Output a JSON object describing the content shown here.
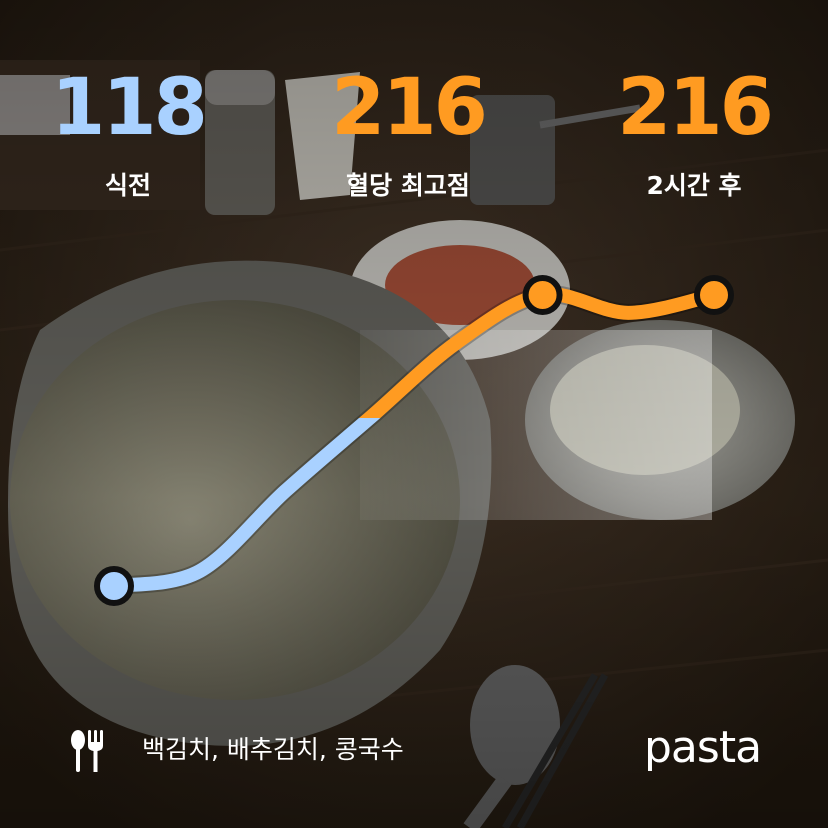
{
  "stats": {
    "pre_meal": {
      "value": "118",
      "label": "식전",
      "color": "#a9d1ff"
    },
    "peak": {
      "value": "216",
      "label": "혈당 최고점",
      "color": "#ff9b21"
    },
    "after_2h": {
      "value": "216",
      "label": "2시간 후",
      "color": "#ff9b21"
    }
  },
  "footer": {
    "meal_icon": "fork-knife-icon",
    "foods": "백김치, 배추김치, 콩국수"
  },
  "brand": {
    "name": "pasta"
  },
  "colors": {
    "low_line": "#a9d1ff",
    "high_line": "#ff9b21",
    "text": "#ffffff"
  },
  "chart_data": {
    "type": "line",
    "series": [
      {
        "values": [
          118,
          123,
          150,
          175,
          200,
          216,
          210,
          216
        ]
      }
    ],
    "y_range": [
      118,
      216
    ]
  }
}
